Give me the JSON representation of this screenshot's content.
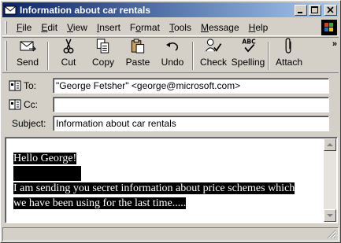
{
  "window": {
    "title": "Information about car rentals"
  },
  "menu": [
    "File",
    "Edit",
    "View",
    "Insert",
    "Format",
    "Tools",
    "Message",
    "Help"
  ],
  "menu_access_keys": [
    "F",
    "E",
    "V",
    "I",
    "o",
    "T",
    "M",
    "H"
  ],
  "toolbar": {
    "buttons": [
      {
        "label": "Send",
        "icon": "send-icon"
      },
      {
        "label": "Cut",
        "icon": "scissors-icon"
      },
      {
        "label": "Copy",
        "icon": "copy-icon"
      },
      {
        "label": "Paste",
        "icon": "paste-icon"
      },
      {
        "label": "Undo",
        "icon": "undo-icon"
      },
      {
        "label": "Check",
        "icon": "check-names-icon"
      },
      {
        "label": "Spelling",
        "icon": "spelling-icon"
      },
      {
        "label": "Attach",
        "icon": "paperclip-icon"
      }
    ],
    "overflow": "»"
  },
  "fields": {
    "to_label": "To:",
    "to_value": "\"George Fetsher\" <george@microsoft.com>",
    "cc_label": "Cc:",
    "cc_value": "",
    "subject_label": "Subject:",
    "subject_value": "Information about car rentals"
  },
  "message": {
    "greeting": "Hello George!",
    "line1": "I am sending you secret information about price schemes which",
    "line2": "we have been using for the last time....."
  },
  "colors": {
    "titlebar_start": "#0a246a",
    "titlebar_end": "#a6caf0",
    "selection": "#000000"
  }
}
